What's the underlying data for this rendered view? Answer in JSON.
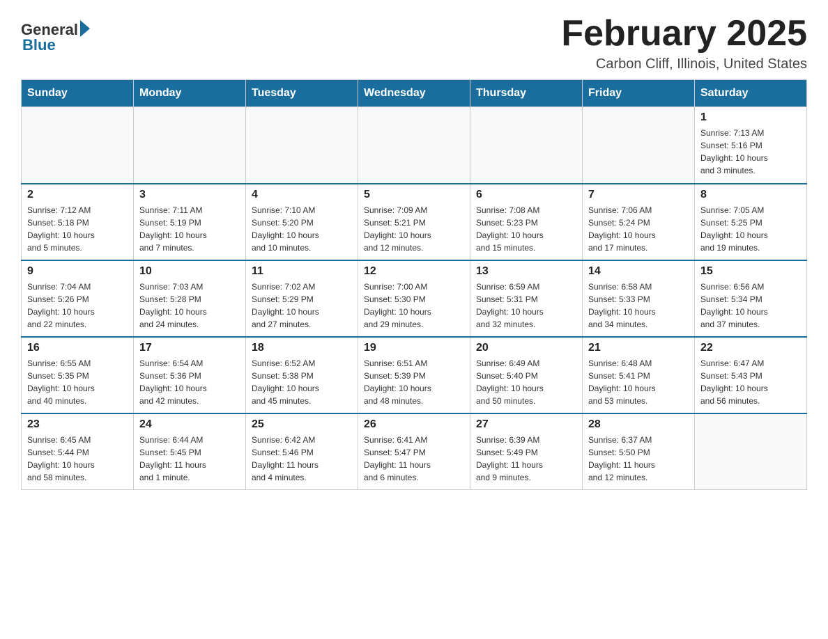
{
  "logo": {
    "general": "General",
    "blue": "Blue"
  },
  "title": "February 2025",
  "location": "Carbon Cliff, Illinois, United States",
  "days_of_week": [
    "Sunday",
    "Monday",
    "Tuesday",
    "Wednesday",
    "Thursday",
    "Friday",
    "Saturday"
  ],
  "weeks": [
    [
      {
        "day": "",
        "info": ""
      },
      {
        "day": "",
        "info": ""
      },
      {
        "day": "",
        "info": ""
      },
      {
        "day": "",
        "info": ""
      },
      {
        "day": "",
        "info": ""
      },
      {
        "day": "",
        "info": ""
      },
      {
        "day": "1",
        "info": "Sunrise: 7:13 AM\nSunset: 5:16 PM\nDaylight: 10 hours\nand 3 minutes."
      }
    ],
    [
      {
        "day": "2",
        "info": "Sunrise: 7:12 AM\nSunset: 5:18 PM\nDaylight: 10 hours\nand 5 minutes."
      },
      {
        "day": "3",
        "info": "Sunrise: 7:11 AM\nSunset: 5:19 PM\nDaylight: 10 hours\nand 7 minutes."
      },
      {
        "day": "4",
        "info": "Sunrise: 7:10 AM\nSunset: 5:20 PM\nDaylight: 10 hours\nand 10 minutes."
      },
      {
        "day": "5",
        "info": "Sunrise: 7:09 AM\nSunset: 5:21 PM\nDaylight: 10 hours\nand 12 minutes."
      },
      {
        "day": "6",
        "info": "Sunrise: 7:08 AM\nSunset: 5:23 PM\nDaylight: 10 hours\nand 15 minutes."
      },
      {
        "day": "7",
        "info": "Sunrise: 7:06 AM\nSunset: 5:24 PM\nDaylight: 10 hours\nand 17 minutes."
      },
      {
        "day": "8",
        "info": "Sunrise: 7:05 AM\nSunset: 5:25 PM\nDaylight: 10 hours\nand 19 minutes."
      }
    ],
    [
      {
        "day": "9",
        "info": "Sunrise: 7:04 AM\nSunset: 5:26 PM\nDaylight: 10 hours\nand 22 minutes."
      },
      {
        "day": "10",
        "info": "Sunrise: 7:03 AM\nSunset: 5:28 PM\nDaylight: 10 hours\nand 24 minutes."
      },
      {
        "day": "11",
        "info": "Sunrise: 7:02 AM\nSunset: 5:29 PM\nDaylight: 10 hours\nand 27 minutes."
      },
      {
        "day": "12",
        "info": "Sunrise: 7:00 AM\nSunset: 5:30 PM\nDaylight: 10 hours\nand 29 minutes."
      },
      {
        "day": "13",
        "info": "Sunrise: 6:59 AM\nSunset: 5:31 PM\nDaylight: 10 hours\nand 32 minutes."
      },
      {
        "day": "14",
        "info": "Sunrise: 6:58 AM\nSunset: 5:33 PM\nDaylight: 10 hours\nand 34 minutes."
      },
      {
        "day": "15",
        "info": "Sunrise: 6:56 AM\nSunset: 5:34 PM\nDaylight: 10 hours\nand 37 minutes."
      }
    ],
    [
      {
        "day": "16",
        "info": "Sunrise: 6:55 AM\nSunset: 5:35 PM\nDaylight: 10 hours\nand 40 minutes."
      },
      {
        "day": "17",
        "info": "Sunrise: 6:54 AM\nSunset: 5:36 PM\nDaylight: 10 hours\nand 42 minutes."
      },
      {
        "day": "18",
        "info": "Sunrise: 6:52 AM\nSunset: 5:38 PM\nDaylight: 10 hours\nand 45 minutes."
      },
      {
        "day": "19",
        "info": "Sunrise: 6:51 AM\nSunset: 5:39 PM\nDaylight: 10 hours\nand 48 minutes."
      },
      {
        "day": "20",
        "info": "Sunrise: 6:49 AM\nSunset: 5:40 PM\nDaylight: 10 hours\nand 50 minutes."
      },
      {
        "day": "21",
        "info": "Sunrise: 6:48 AM\nSunset: 5:41 PM\nDaylight: 10 hours\nand 53 minutes."
      },
      {
        "day": "22",
        "info": "Sunrise: 6:47 AM\nSunset: 5:43 PM\nDaylight: 10 hours\nand 56 minutes."
      }
    ],
    [
      {
        "day": "23",
        "info": "Sunrise: 6:45 AM\nSunset: 5:44 PM\nDaylight: 10 hours\nand 58 minutes."
      },
      {
        "day": "24",
        "info": "Sunrise: 6:44 AM\nSunset: 5:45 PM\nDaylight: 11 hours\nand 1 minute."
      },
      {
        "day": "25",
        "info": "Sunrise: 6:42 AM\nSunset: 5:46 PM\nDaylight: 11 hours\nand 4 minutes."
      },
      {
        "day": "26",
        "info": "Sunrise: 6:41 AM\nSunset: 5:47 PM\nDaylight: 11 hours\nand 6 minutes."
      },
      {
        "day": "27",
        "info": "Sunrise: 6:39 AM\nSunset: 5:49 PM\nDaylight: 11 hours\nand 9 minutes."
      },
      {
        "day": "28",
        "info": "Sunrise: 6:37 AM\nSunset: 5:50 PM\nDaylight: 11 hours\nand 12 minutes."
      },
      {
        "day": "",
        "info": ""
      }
    ]
  ]
}
